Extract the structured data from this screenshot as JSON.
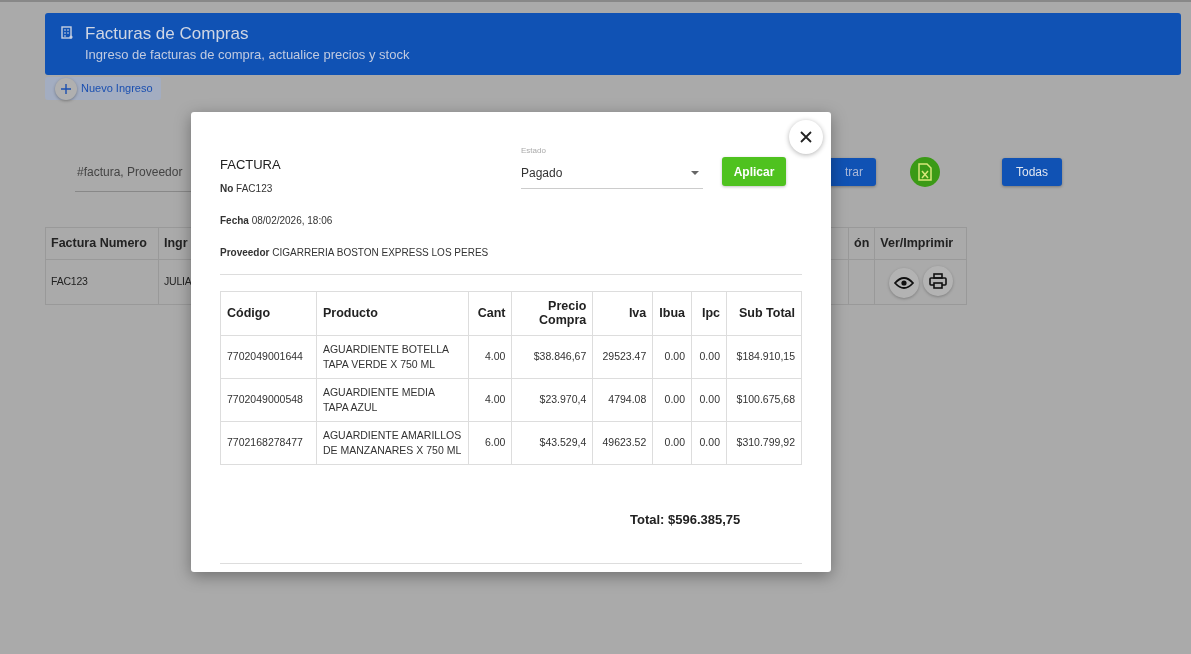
{
  "header": {
    "title": "Facturas de Compras",
    "subtitle": "Ingreso de facturas de compra, actualice precios y stock"
  },
  "new_button": "Nuevo Ingreso",
  "search": {
    "placeholder": "#factura, Proveedor"
  },
  "filter_button": "trar",
  "all_button": "Todas",
  "list_table": {
    "columns": [
      "Factura Numero",
      "Ingr",
      "",
      "ón",
      "Ver/Imprimir"
    ],
    "rows": [
      [
        "FAC123",
        "JULIA",
        "",
        ""
      ]
    ]
  },
  "modal": {
    "title": "FACTURA",
    "fields": [
      {
        "label": "No",
        "value": "FAC123"
      },
      {
        "label": "Fecha",
        "value": "08/02/2026, 18:06"
      },
      {
        "label": "Proveedor",
        "value": "CIGARRERIA BOSTON EXPRESS LOS PERES"
      }
    ],
    "status": {
      "label": "Estado",
      "value": "Pagado"
    },
    "apply_button": "Aplicar",
    "columns": [
      "Código",
      "Producto",
      "Cant",
      "Precio Compra",
      "Iva",
      "Ibua",
      "Ipc",
      "Sub Total"
    ],
    "rows": [
      [
        "7702049001644",
        "AGUARDIENTE BOTELLA TAPA VERDE X 750 ML",
        "4.00",
        "$38.846,67",
        "29523.47",
        "0.00",
        "0.00",
        "$184.910,15"
      ],
      [
        "7702049000548",
        "AGUARDIENTE MEDIA TAPA AZUL",
        "4.00",
        "$23.970,4",
        "4794.08",
        "0.00",
        "0.00",
        "$100.675,68"
      ],
      [
        "7702168278477",
        "AGUARDIENTE AMARILLOS DE MANZANARES X 750 ML",
        "6.00",
        "$43.529,4",
        "49623.52",
        "0.00",
        "0.00",
        "$310.799,92"
      ]
    ],
    "total": {
      "label": "Total:",
      "value": "$596.385,75"
    }
  }
}
